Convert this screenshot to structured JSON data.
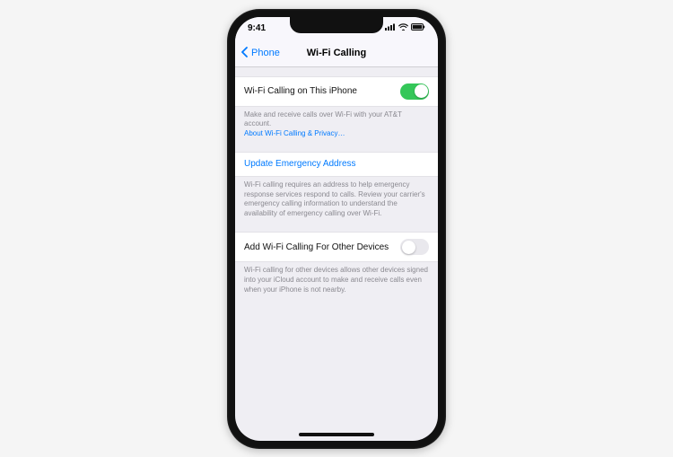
{
  "status": {
    "time": "9:41"
  },
  "nav": {
    "back_label": "Phone",
    "title": "Wi-Fi Calling"
  },
  "rows": {
    "wifi_calling": {
      "label": "Wi-Fi Calling on This iPhone",
      "toggle_on": true
    },
    "footer1_text": "Make and receive calls over Wi-Fi with your AT&T account.",
    "footer1_link": "About Wi-Fi Calling & Privacy…",
    "update_address": {
      "label": "Update Emergency Address"
    },
    "footer2_text": "Wi-Fi calling requires an address to help emergency response services respond to calls. Review your carrier's emergency calling information to understand the availability of emergency calling over Wi-Fi.",
    "other_devices": {
      "label": "Add Wi-Fi Calling For Other Devices",
      "toggle_on": false
    },
    "footer3_text": "Wi-Fi calling for other devices allows other devices signed into your iCloud account to make and receive calls even when your iPhone is not nearby."
  }
}
